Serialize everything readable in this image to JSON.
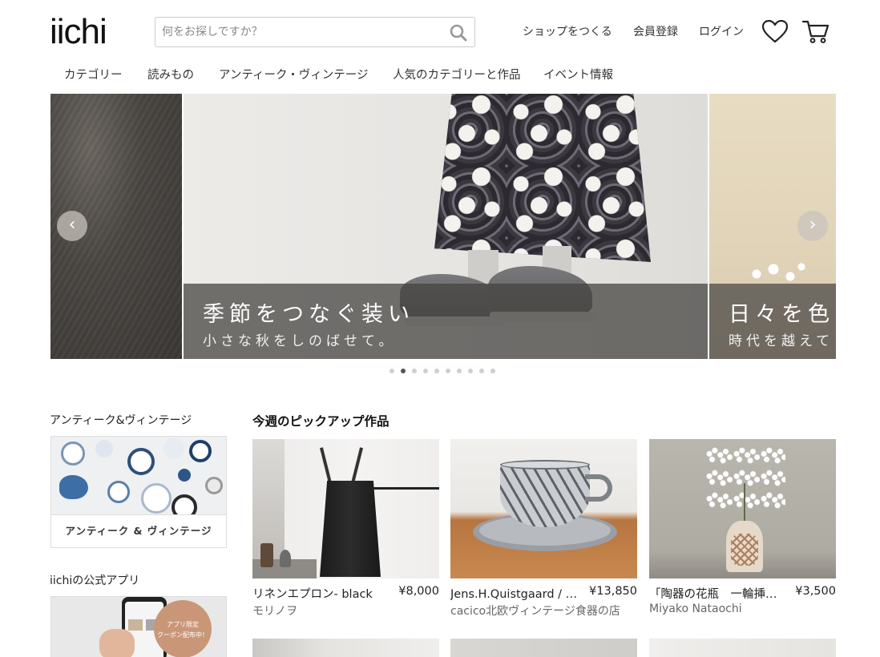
{
  "header": {
    "logo": "iichi",
    "search_placeholder": "何をお探しですか？",
    "links": [
      "ショップをつくる",
      "会員登録",
      "ログイン"
    ],
    "icons": [
      "heart-icon",
      "cart-icon",
      "search-icon"
    ]
  },
  "nav": [
    "カテゴリー",
    "読みもの",
    "アンティーク・ヴィンテージ",
    "人気のカテゴリーと作品",
    "イベント情報"
  ],
  "hero": {
    "main_title": "季節をつなぐ装い",
    "main_sub": "小さな秋をしのばせて。",
    "right_title": "日々を色",
    "right_sub": "時代を越えて",
    "prev": "‹",
    "next": "›",
    "slide_count": 10,
    "active_index": 1
  },
  "sidebar": {
    "antique_title": "アンティーク&ヴィンテージ",
    "antique_card_label": "アンティーク & ヴィンテージ",
    "app_title": "iichiの公式アプリ",
    "app_badge_line1": "アプリ限定",
    "app_badge_line2": "クーポン配布中！"
  },
  "pickup": {
    "title": "今週のピックアップ作品",
    "items": [
      {
        "name": "リネンエプロン- black",
        "price": "¥8,000",
        "shop": "モリノヲ"
      },
      {
        "name": "Jens.H.Quistgaard / イ…",
        "price": "¥13,850",
        "shop": "cacico北欧ヴィンテージ食器の店"
      },
      {
        "name": "「陶器の花瓶　一輪挿し…",
        "price": "¥3,500",
        "shop": "Miyako Nataochi"
      }
    ]
  },
  "colors": {
    "text": "#222222",
    "caption_bg": "#464442",
    "dot_active": "#555555",
    "dot_inactive": "#cfcfcf"
  }
}
